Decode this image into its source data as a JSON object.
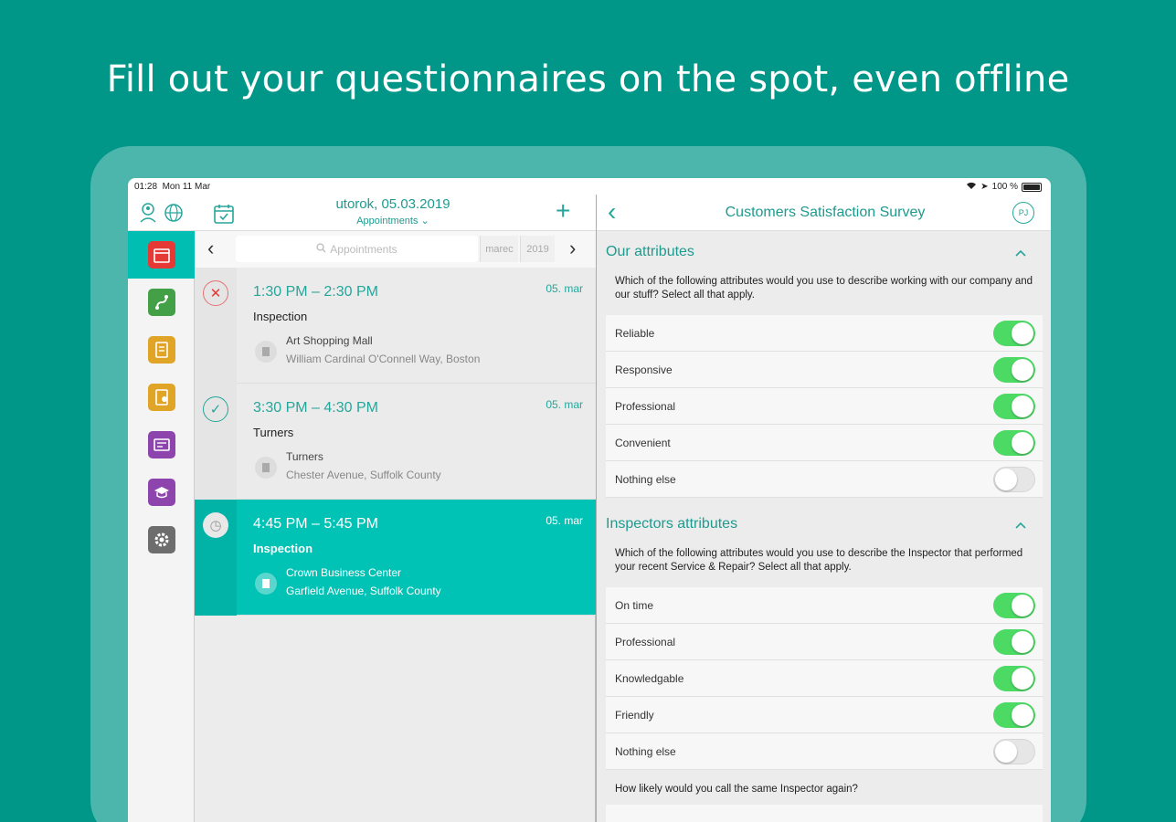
{
  "headline": "Fill out your questionnaires on the spot, even offline",
  "statusbar": {
    "time": "01:28",
    "date": "Mon 11 Mar",
    "battery": "100 %"
  },
  "left_nav": {
    "date": "utorok, 05.03.2019",
    "subtitle": "Appointments ⌄",
    "add": "+"
  },
  "search": {
    "placeholder": "Appointments",
    "month": "marec",
    "year": "2019",
    "prev": "‹",
    "next": "›"
  },
  "appointments": [
    {
      "time": "1:30 PM – 2:30 PM",
      "date": "05. mar",
      "title": "Inspection",
      "place": "Art Shopping Mall",
      "address": "William Cardinal O'Connell Way, Boston",
      "status": "cancelled",
      "status_glyph": "✕"
    },
    {
      "time": "3:30 PM – 4:30 PM",
      "date": "05. mar",
      "title": "Turners",
      "place": "Turners",
      "address": "Chester Avenue, Suffolk County",
      "status": "done",
      "status_glyph": "✓"
    },
    {
      "time": "4:45 PM – 5:45 PM",
      "date": "05. mar",
      "title": "Inspection",
      "place": "Crown Business Center",
      "address": "Garfield Avenue, Suffolk County",
      "status": "pending",
      "status_glyph": "◷"
    }
  ],
  "sidebar_colors": [
    "#e53935",
    "#43a047",
    "#e0a526",
    "#e0a526",
    "#8e44ad",
    "#8e44ad",
    "#6d6d6d"
  ],
  "survey": {
    "back": "‹",
    "title": "Customers Satisfaction Survey",
    "avatar": "PJ",
    "sections": [
      {
        "heading": "Our attributes",
        "question": "Which of the following attributes would you use to describe working with our company and our stuff? Select all that apply.",
        "options": [
          {
            "label": "Reliable",
            "on": true
          },
          {
            "label": "Responsive",
            "on": true
          },
          {
            "label": "Professional",
            "on": true
          },
          {
            "label": "Convenient",
            "on": true
          },
          {
            "label": "Nothing else",
            "on": false
          }
        ]
      },
      {
        "heading": "Inspectors attributes",
        "question": "Which of the following attributes would you use to describe the Inspector that performed your recent Service & Repair? Select all that apply.",
        "options": [
          {
            "label": "On time",
            "on": true
          },
          {
            "label": "Professional",
            "on": true
          },
          {
            "label": "Knowledgable",
            "on": true
          },
          {
            "label": "Friendly",
            "on": true
          },
          {
            "label": "Nothing else",
            "on": false
          }
        ]
      }
    ],
    "final_question": "How likely would you call the same Inspector again?"
  }
}
